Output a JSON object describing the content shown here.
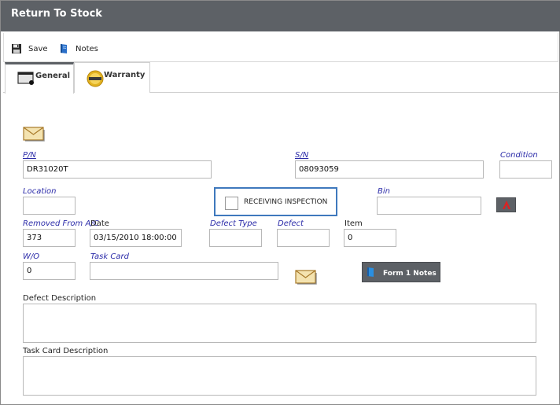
{
  "window": {
    "title": "Return To Stock"
  },
  "toolbar": {
    "save_label": "Save",
    "notes_label": "Notes"
  },
  "tabs": [
    {
      "label": "General"
    },
    {
      "label": "Warranty"
    }
  ],
  "form": {
    "pn": {
      "label": "P/N",
      "value": "DR31020T"
    },
    "sn": {
      "label": "S/N",
      "value": "08093059"
    },
    "condition": {
      "label": "Condition",
      "value": ""
    },
    "location": {
      "label": "Location",
      "value": ""
    },
    "receiving_inspection": {
      "label": "RECEIVING INSPECTION",
      "checked": false
    },
    "bin": {
      "label": "Bin",
      "value": ""
    },
    "removed_from_ac": {
      "label": "Removed From A/C",
      "value": "373"
    },
    "date": {
      "label": "Date",
      "value": "03/15/2010 18:00:00"
    },
    "defect_type": {
      "label": "Defect Type",
      "value": ""
    },
    "defect": {
      "label": "Defect",
      "value": ""
    },
    "item": {
      "label": "Item",
      "value": "0"
    },
    "wo": {
      "label": "W/O",
      "value": "0"
    },
    "task_card": {
      "label": "Task Card",
      "value": ""
    },
    "form1_notes": {
      "label": "Form 1 Notes"
    },
    "defect_description": {
      "label": "Defect Description",
      "value": ""
    },
    "task_card_description": {
      "label": "Task Card Description",
      "value": ""
    }
  },
  "colors": {
    "titlebar": "#5d6166",
    "label_blue": "#2a2aa8",
    "highlight_border": "#3f79bd"
  },
  "icons": {
    "save": "floppy-disk-icon",
    "notes": "notebook-icon",
    "general_tab": "window-icon",
    "warranty_tab": "warranty-badge-icon",
    "envelope": "envelope-icon",
    "bin_lookup": "red-a-icon"
  }
}
